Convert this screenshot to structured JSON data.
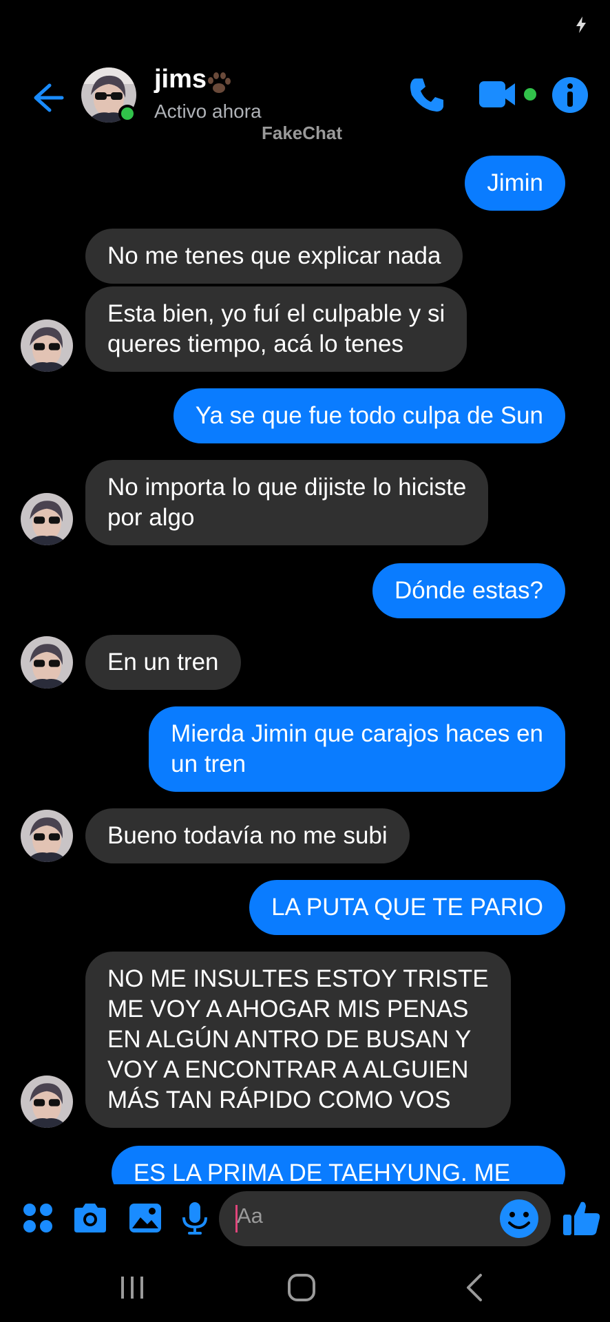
{
  "header": {
    "contact_name": "jims",
    "status": "Activo ahora",
    "watermark": "FakeChat"
  },
  "messages": [
    {
      "dir": "out",
      "text": "Jimin"
    },
    {
      "dir": "in",
      "text": "No me tenes que explicar nada"
    },
    {
      "dir": "in",
      "text": "Esta bien, yo fuí el culpable y si\nqueres tiempo, acá lo tenes"
    },
    {
      "dir": "out",
      "text": "Ya se que fue todo culpa de Sun"
    },
    {
      "dir": "in",
      "text": "No importa lo que dijiste lo hiciste\npor algo"
    },
    {
      "dir": "out",
      "text": "Dónde estas?"
    },
    {
      "dir": "in",
      "text": "En un tren"
    },
    {
      "dir": "out",
      "text": "Mierda Jimin que carajos haces en\nun tren"
    },
    {
      "dir": "in",
      "text": "Bueno todavía no me subi"
    },
    {
      "dir": "out",
      "text": "LA PUTA QUE TE PARIO"
    },
    {
      "dir": "in",
      "text": "NO ME INSULTES ESTOY TRISTE\nME VOY A AHOGAR MIS PENAS\nEN ALGÚN ANTRO DE BUSAN Y\nVOY A ENCONTRAR A ALGUIEN\nMÁS TAN RÁPIDO COMO VOS"
    },
    {
      "dir": "out",
      "text": "ES LA PRIMA DE TAEHYUNG. ME"
    }
  ],
  "composer": {
    "placeholder": "Aa"
  },
  "icons": {
    "back": "arrow-left-icon",
    "call": "phone-icon",
    "video": "video-camera-icon",
    "info": "info-icon",
    "apps": "four-dots-icon",
    "camera": "camera-icon",
    "gallery": "image-icon",
    "mic": "microphone-icon",
    "emoji": "emoji-icon",
    "like": "thumbs-up-icon"
  },
  "colors": {
    "accent": "#0a7cff",
    "incoming_bubble": "#303030",
    "online": "#31c24a",
    "background": "#000000"
  }
}
